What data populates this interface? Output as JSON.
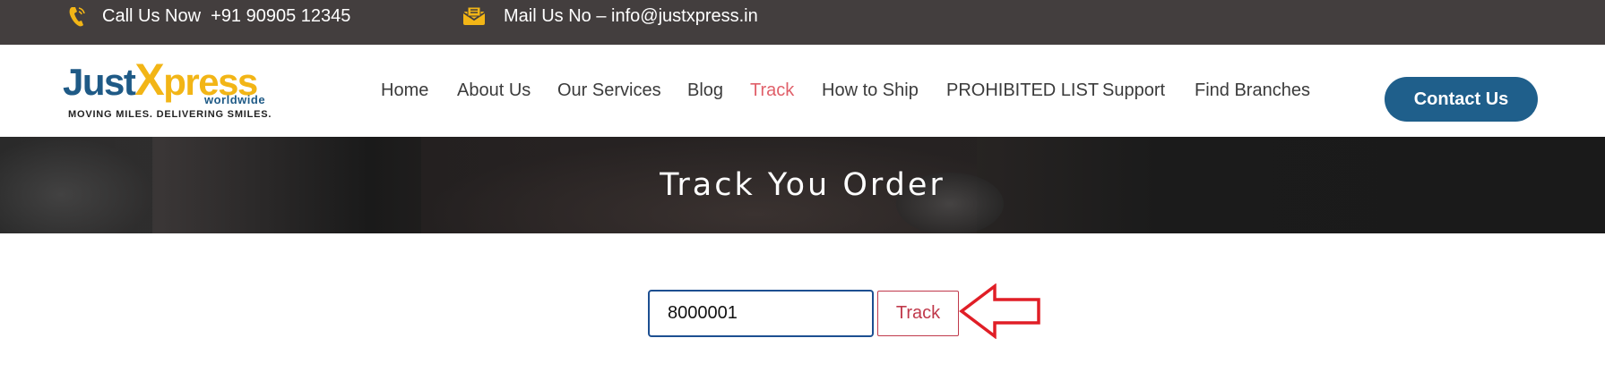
{
  "topbar": {
    "call_icon": "phone-icon",
    "call_text": "Call Us Now  +91 90905 12345",
    "mail_icon": "envelope-icon",
    "mail_text": "Mail Us No – info@justxpress.in"
  },
  "logo": {
    "just": "Just",
    "x": "X",
    "press": "press",
    "sub": "worldwide",
    "tagline": "MOVING MILES. DELIVERING SMILES."
  },
  "nav": {
    "items": [
      {
        "label": "Home"
      },
      {
        "label": "About Us"
      },
      {
        "label": "Our Services"
      },
      {
        "label": "Blog"
      },
      {
        "label": "Track"
      },
      {
        "label": "How to Ship"
      },
      {
        "label": "PROHIBITED LIST"
      },
      {
        "label": "Support"
      },
      {
        "label": "Find Branches"
      }
    ],
    "active_color": "#e0606a"
  },
  "contact": {
    "label": "Contact Us",
    "color": "#1f5f8b"
  },
  "banner": {
    "title": "Track You Order"
  },
  "track_form": {
    "input_value": "8000001",
    "button_label": "Track",
    "arrow_icon": "red-arrow-icon",
    "arrow_color": "#e01e26"
  },
  "colors": {
    "topbar_bg": "#433e3e",
    "brand_blue": "#1f5a86",
    "brand_yellow": "#f2b516"
  }
}
